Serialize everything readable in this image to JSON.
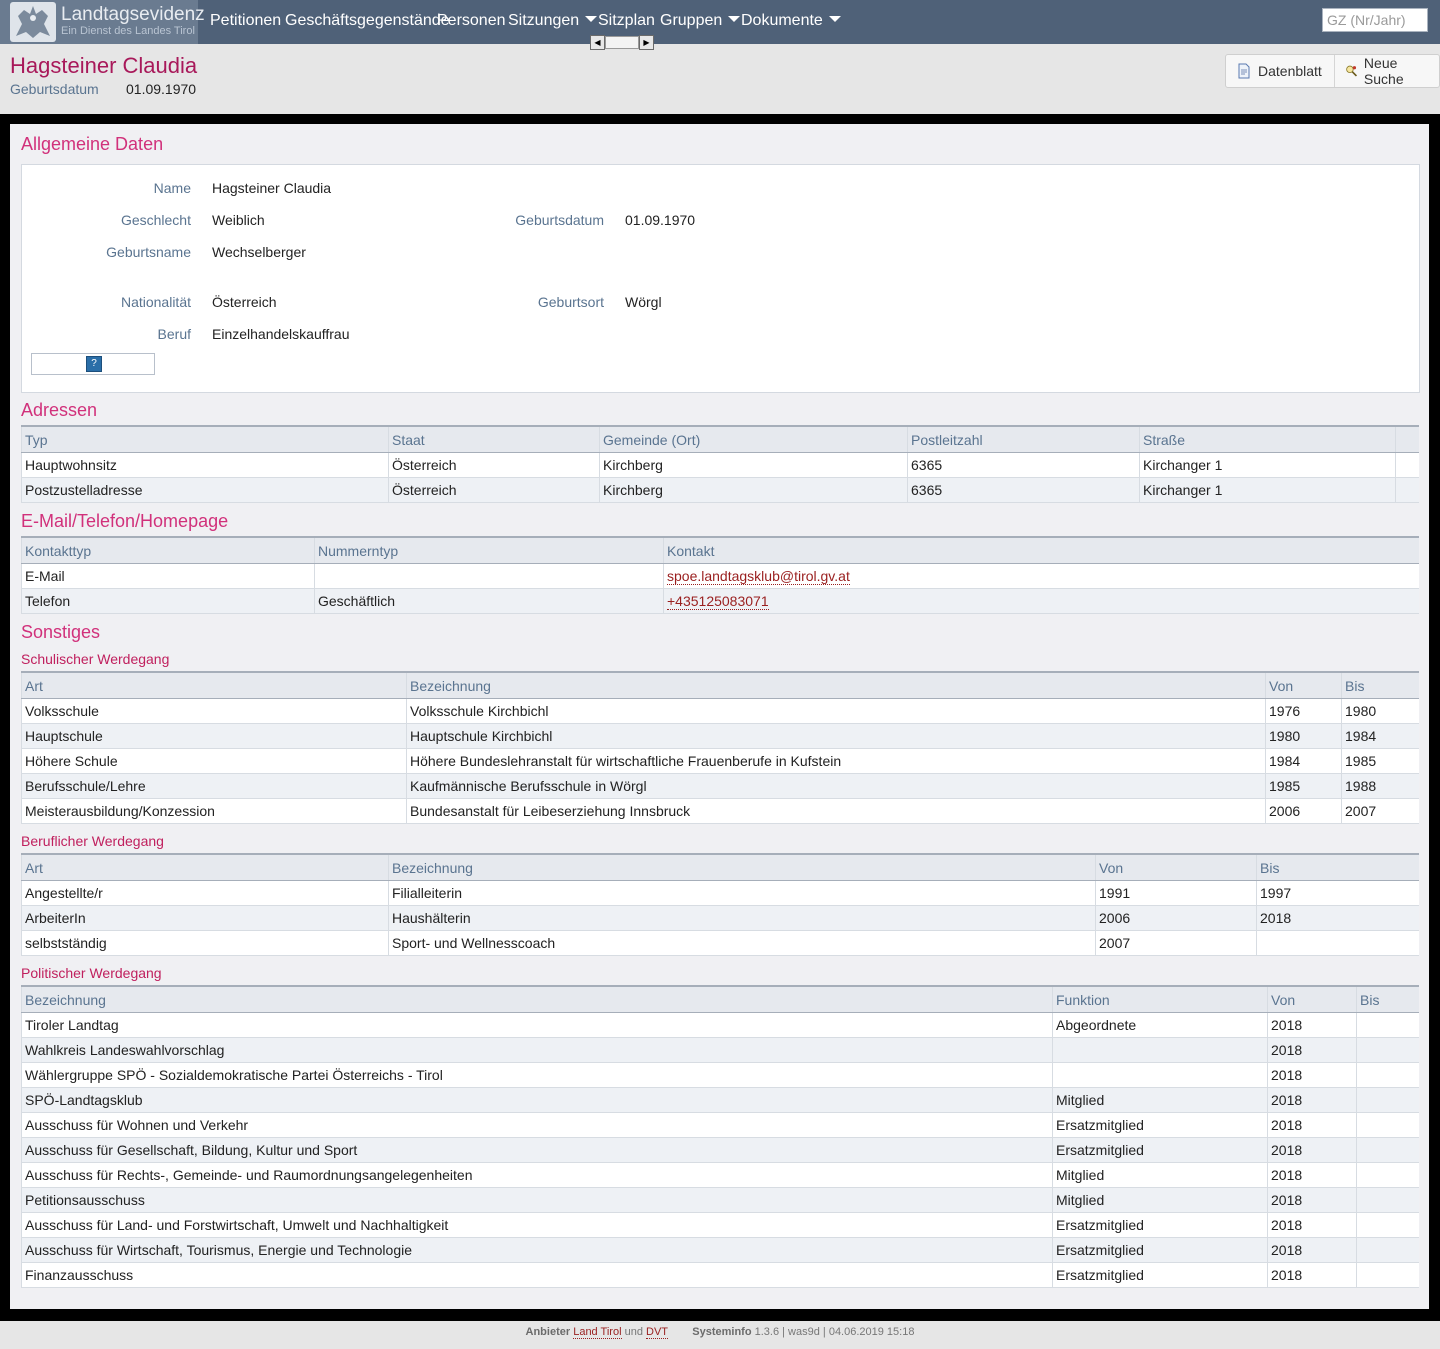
{
  "brand": {
    "title": "Landtagsevidenz",
    "subtitle": "Ein Dienst des Landes Tirol"
  },
  "nav": {
    "items": [
      {
        "label": "Petitionen"
      },
      {
        "label": "Geschäftsgegenstände"
      },
      {
        "label": "Personen"
      },
      {
        "label": "Sitzungen"
      },
      {
        "label": "Sitzplan"
      },
      {
        "label": "Gruppen"
      },
      {
        "label": "Dokumente"
      }
    ],
    "search_placeholder": "GZ (Nr/Jahr)"
  },
  "header": {
    "name": "Hagsteiner Claudia",
    "dob_label": "Geburtsdatum",
    "dob_value": "01.09.1970",
    "actions": [
      "Datenblatt",
      "Neue Suche"
    ]
  },
  "general": {
    "title": "Allgemeine Daten",
    "name_label": "Name",
    "name": "Hagsteiner Claudia",
    "gender_label": "Geschlecht",
    "gender": "Weiblich",
    "dob_label": "Geburtsdatum",
    "dob": "01.09.1970",
    "birthname_label": "Geburtsname",
    "birthname": "Wechselberger",
    "nationality_label": "Nationalität",
    "nationality": "Österreich",
    "birthplace_label": "Geburtsort",
    "birthplace": "Wörgl",
    "job_label": "Beruf",
    "job": "Einzelhandelskauffrau",
    "help_glyph": "?"
  },
  "addresses": {
    "title": "Adressen",
    "headers": [
      "Typ",
      "Staat",
      "Gemeinde (Ort)",
      "Postleitzahl",
      "Straße"
    ],
    "rows": [
      [
        "Hauptwohnsitz",
        "Österreich",
        "Kirchberg",
        "6365",
        "Kirchanger 1"
      ],
      [
        "Postzustelladresse",
        "Österreich",
        "Kirchberg",
        "6365",
        "Kirchanger 1"
      ]
    ]
  },
  "contacts": {
    "title": "E-Mail/Telefon/Homepage",
    "headers": [
      "Kontakttyp",
      "Nummerntyp",
      "Kontakt"
    ],
    "rows": [
      [
        "E-Mail",
        "",
        "spoe.landtagsklub@tirol.gv.at"
      ],
      [
        "Telefon",
        "Geschäftlich",
        "+435125083071"
      ]
    ]
  },
  "other": {
    "title": "Sonstiges",
    "school": {
      "title": "Schulischer Werdegang",
      "headers": [
        "Art",
        "Bezeichnung",
        "Von",
        "Bis"
      ],
      "rows": [
        [
          "Volksschule",
          "Volksschule Kirchbichl",
          "1976",
          "1980"
        ],
        [
          "Hauptschule",
          "Hauptschule Kirchbichl",
          "1980",
          "1984"
        ],
        [
          "Höhere Schule",
          "Höhere Bundeslehranstalt für wirtschaftliche Frauenberufe in Kufstein",
          "1984",
          "1985"
        ],
        [
          "Berufsschule/Lehre",
          "Kaufmännische Berufsschule in Wörgl",
          "1985",
          "1988"
        ],
        [
          "Meisterausbildung/Konzession",
          "Bundesanstalt für Leibeserziehung Innsbruck",
          "2006",
          "2007"
        ]
      ]
    },
    "career": {
      "title": "Beruflicher Werdegang",
      "headers": [
        "Art",
        "Bezeichnung",
        "Von",
        "Bis"
      ],
      "rows": [
        [
          "Angestellte/r",
          "Filialleiterin",
          "1991",
          "1997"
        ],
        [
          "ArbeiterIn",
          "Haushälterin",
          "2006",
          "2018"
        ],
        [
          "selbstständig",
          "Sport- und Wellnesscoach",
          "2007",
          ""
        ]
      ]
    },
    "politics": {
      "title": "Politischer Werdegang",
      "headers": [
        "Bezeichnung",
        "Funktion",
        "Von",
        "Bis"
      ],
      "rows": [
        [
          "Tiroler Landtag",
          "Abgeordnete",
          "2018",
          ""
        ],
        [
          "Wahlkreis Landeswahlvorschlag",
          "",
          "2018",
          ""
        ],
        [
          "Wählergruppe SPÖ - Sozialdemokratische Partei Österreichs - Tirol",
          "",
          "2018",
          ""
        ],
        [
          "SPÖ-Landtagsklub",
          "Mitglied",
          "2018",
          ""
        ],
        [
          "Ausschuss für Wohnen und Verkehr",
          "Ersatzmitglied",
          "2018",
          ""
        ],
        [
          "Ausschuss für Gesellschaft, Bildung, Kultur und Sport",
          "Ersatzmitglied",
          "2018",
          ""
        ],
        [
          "Ausschuss für Rechts-, Gemeinde- und Raumordnungsangelegenheiten",
          "Mitglied",
          "2018",
          ""
        ],
        [
          "Petitionsausschuss",
          "Mitglied",
          "2018",
          ""
        ],
        [
          "Ausschuss für Land- und Forstwirtschaft, Umwelt und Nachhaltigkeit",
          "Ersatzmitglied",
          "2018",
          ""
        ],
        [
          "Ausschuss für Wirtschaft, Tourismus, Energie und Technologie",
          "Ersatzmitglied",
          "2018",
          ""
        ],
        [
          "Finanzausschuss",
          "Ersatzmitglied",
          "2018",
          ""
        ]
      ]
    }
  },
  "footer": {
    "provider_label": "Anbieter",
    "provider_1": "Land Tirol",
    "and": "und",
    "provider_2": "DVT",
    "sysinfo_label": "Systeminfo",
    "sysinfo": "1.3.6 | was9d | 04.06.2019 15:18"
  }
}
